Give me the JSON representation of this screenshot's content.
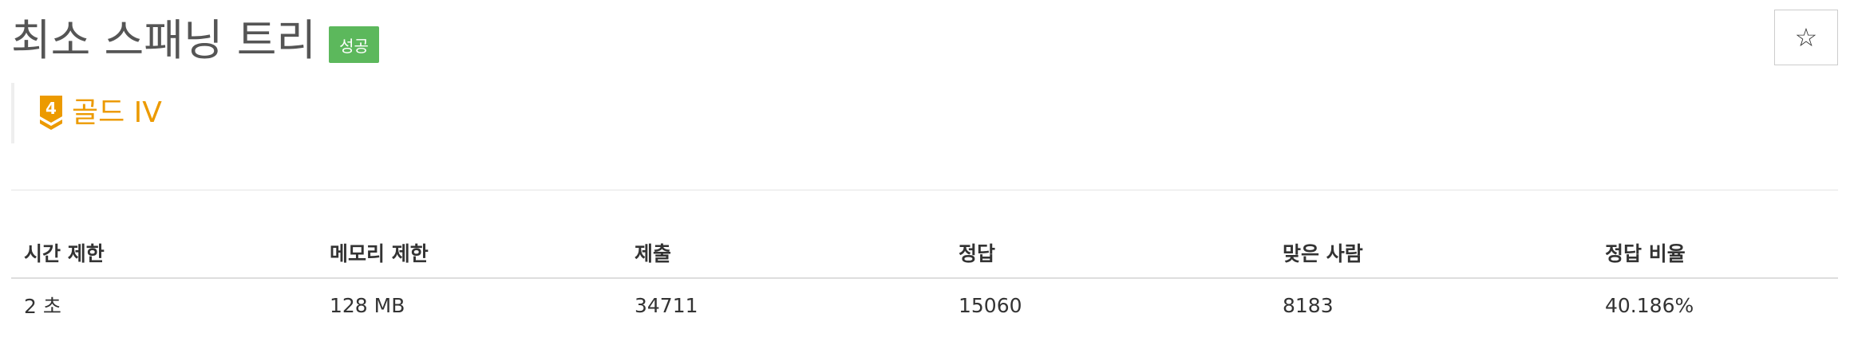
{
  "problem": {
    "title": "최소 스패닝 트리",
    "status_badge": "성공",
    "status_color": "#5cb85c"
  },
  "star_button": {
    "symbol": "☆",
    "icon": "star-outline-icon"
  },
  "tier": {
    "number": "4",
    "label": "골드 IV",
    "color": "#ec9a00",
    "icon": "gold-tier-badge-icon"
  },
  "info_table": {
    "headers": [
      "시간 제한",
      "메모리 제한",
      "제출",
      "정답",
      "맞은 사람",
      "정답 비율"
    ],
    "rows": [
      [
        "2 초",
        "128 MB",
        "34711",
        "15060",
        "8183",
        "40.186%"
      ]
    ]
  }
}
